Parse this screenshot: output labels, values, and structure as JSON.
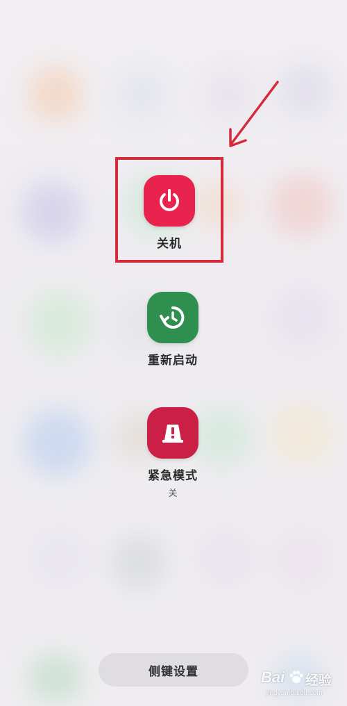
{
  "power_menu": {
    "options": [
      {
        "label": "关机",
        "icon": "power-icon",
        "color": "#e8234e"
      },
      {
        "label": "重新启动",
        "icon": "restart-icon",
        "color": "#2f8f4f"
      },
      {
        "label": "紧急模式",
        "sublabel": "关",
        "icon": "emergency-icon",
        "color": "#cc1f45"
      }
    ],
    "side_key_settings": "侧键设置"
  },
  "annotation": {
    "highlight_color": "#d42a3c"
  },
  "watermark": {
    "brand": "Bai",
    "cn": "经验",
    "url": "jingyan.baidu.com"
  }
}
